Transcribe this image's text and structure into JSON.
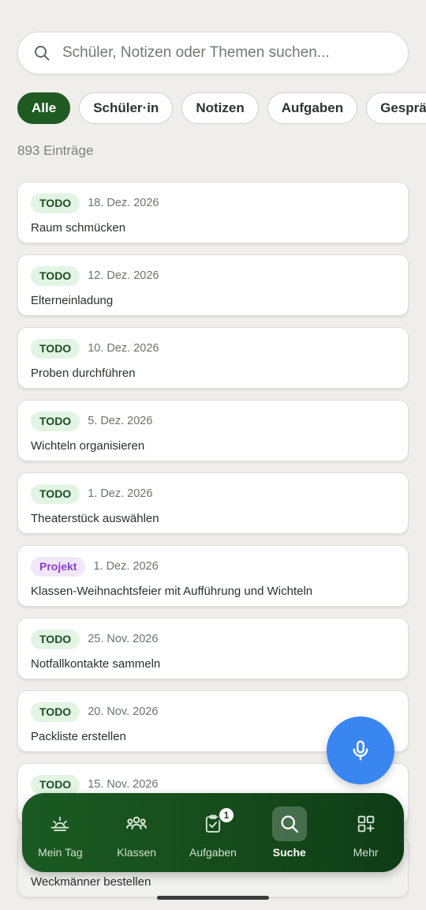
{
  "search": {
    "placeholder": "Schüler, Notizen oder Themen suchen..."
  },
  "filters": [
    {
      "label": "Alle",
      "active": true
    },
    {
      "label": "Schüler·in",
      "active": false
    },
    {
      "label": "Notizen",
      "active": false
    },
    {
      "label": "Aufgaben",
      "active": false
    },
    {
      "label": "Gespräche",
      "active": false
    }
  ],
  "result_count": "893 Einträge",
  "entries": [
    {
      "badge": "TODO",
      "date": "18. Dez. 2026",
      "title": "Raum schmücken"
    },
    {
      "badge": "TODO",
      "date": "12. Dez. 2026",
      "title": "Elterneinladung"
    },
    {
      "badge": "TODO",
      "date": "10. Dez. 2026",
      "title": "Proben durchführen"
    },
    {
      "badge": "TODO",
      "date": "5. Dez. 2026",
      "title": "Wichteln organisieren"
    },
    {
      "badge": "TODO",
      "date": "1. Dez. 2026",
      "title": "Theaterstück auswählen"
    },
    {
      "badge": "Projekt",
      "date": "1. Dez. 2026",
      "title": "Klassen-Weihnachtsfeier mit Aufführung und Wichteln"
    },
    {
      "badge": "TODO",
      "date": "25. Nov. 2026",
      "title": "Notfallkontakte sammeln"
    },
    {
      "badge": "TODO",
      "date": "20. Nov. 2026",
      "title": "Packliste erstellen"
    },
    {
      "badge": "TODO",
      "date": "15. Nov. 2026",
      "title": ""
    },
    {
      "badge": "",
      "date": "",
      "title": "Weckmänner bestellen"
    }
  ],
  "nav": {
    "items": [
      {
        "label": "Mein Tag",
        "icon": "sunrise-icon"
      },
      {
        "label": "Klassen",
        "icon": "group-icon"
      },
      {
        "label": "Aufgaben",
        "icon": "clipboard-check-icon",
        "badge": "1"
      },
      {
        "label": "Suche",
        "icon": "search-icon",
        "active": true
      },
      {
        "label": "Mehr",
        "icon": "grid-plus-icon"
      }
    ]
  },
  "colors": {
    "primary_green": "#1f5a22",
    "todo_badge_bg": "#e2f4e4",
    "projekt_badge_text": "#8a3fc7",
    "fab_blue": "#3a86f0",
    "background": "#efeeeb"
  }
}
